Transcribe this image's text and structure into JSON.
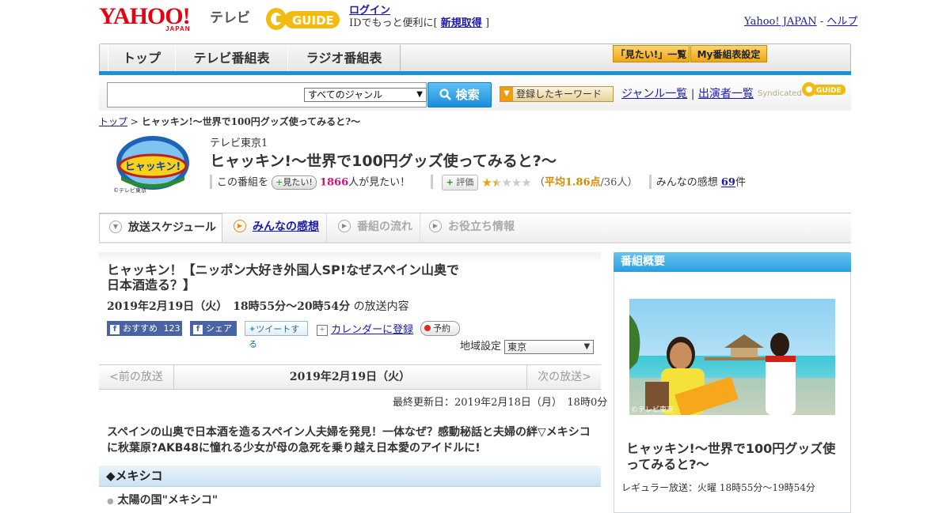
{
  "header": {
    "yahoo_logo": "YAHOO!",
    "yahoo_sub": "JAPAN",
    "tv_label": "テレビ",
    "gguide_logo": "G-GUIDE",
    "login_link": "ログイン",
    "login_tagline_prefix": "IDでもっと便利に[",
    "register_link": "新規取得",
    "login_tagline_suffix": "]",
    "yahoo_japan_link": "Yahoo! JAPAN",
    "separator": "-",
    "help_link": "ヘルプ"
  },
  "nav": {
    "tabs": [
      {
        "label": "トップ"
      },
      {
        "label": "テレビ番組表"
      },
      {
        "label": "ラジオ番組表"
      }
    ],
    "mitai_list": "「見たい!」一覧",
    "my_program": "My番組表設定"
  },
  "search": {
    "input_value": "",
    "genre_selected": "すべてのジャンル",
    "search_button": "検索",
    "keyword_button": "登録したキーワード",
    "genre_list_link": "ジャンル一覧",
    "divider": "|",
    "performer_link": "出演者一覧",
    "syndicated": "Syndicated"
  },
  "breadcrumb": {
    "top": "トップ",
    "arrow": ">",
    "current": "ヒャッキン!～世界で100円グッズ使ってみると?～"
  },
  "program": {
    "logo_text": "ヒャッキン!",
    "logo_copyright": "©テレビ東京",
    "channel": "テレビ東京1",
    "title": "ヒャッキン!～世界で100円グッズ使ってみると?～",
    "this_program": "この番組を",
    "mitai_button": "見たい!",
    "mitai_count": "1866",
    "mitai_suffix": "人が見たい！",
    "rating_button": "評価",
    "rating_stars": 1.86,
    "avg_open": "（",
    "avg_label": "平均1.86点",
    "avg_count": "/36人）",
    "impressions_label": "みんなの感想",
    "impressions_count": "69",
    "impressions_suffix": "件"
  },
  "content_tabs": [
    {
      "label": "放送スケジュール",
      "state": "active"
    },
    {
      "label": "みんなの感想",
      "state": "link"
    },
    {
      "label": "番組の流れ",
      "state": "disabled"
    },
    {
      "label": "お役立ち情報",
      "state": "disabled"
    }
  ],
  "episode": {
    "title": "ヒャッキン！【ニッポン大好き外国人SP!なぜスペイン山奥で日本酒造る？】",
    "date_bold": "2019年2月19日（火）　18時55分～20時54分",
    "date_suffix": "の放送内容",
    "fb_recommend": "おすすめ",
    "fb_count": "123",
    "fb_share": "シェア",
    "tweet": "ツイートする",
    "calendar": "カレンダーに登録",
    "reserve": "予約",
    "region_label": "地域設定",
    "region_value": "東京",
    "prev": "<前の放送",
    "current_date": "2019年2月19日（火）",
    "next": "次の放送>",
    "updated": "最終更新日：2019年2月18日（月）　18時0分",
    "description": "スペインの山奥で日本酒を造るスペイン人夫婦を発見！一体なぜ？感動秘話と夫婦の絆▽メキシコに秋葉原?AKB48に憧れる少女が母の急死を乗り越え日本愛のアイドルに!",
    "section_title": "◆メキシコ",
    "sub_item": "太陽の国\"メキシコ\""
  },
  "sidebar": {
    "header": "番組概要",
    "photo_caption": "©テレビ東京",
    "title": "ヒャッキン!～世界で100円グッズ使ってみると?～",
    "regular": "レギュラー放送：火曜 18時55分～19時54分"
  },
  "colors": {
    "accent_blue": "#1e8fd0",
    "yahoo_red": "#e50012",
    "count_pink": "#d3127f",
    "rating_orange": "#d78a00",
    "link": "#1a1aa6"
  }
}
